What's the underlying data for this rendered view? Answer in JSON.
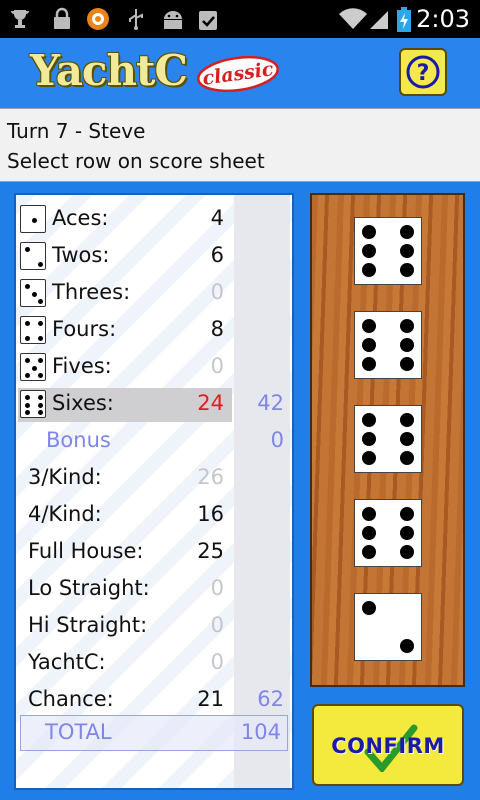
{
  "status_bar": {
    "time": "2:03",
    "icons": [
      "trophy-icon",
      "lock-icon",
      "avast-icon",
      "usb-icon",
      "android-icon",
      "clipboard-check-icon",
      "wifi-icon",
      "signal-icon",
      "battery-charging-icon"
    ]
  },
  "header": {
    "title": "YachtC",
    "badge": "classic",
    "help_label": "?"
  },
  "message": {
    "turn": "Turn 7 - Steve",
    "instruction": "Select row on score sheet"
  },
  "score_sheet": {
    "upper": [
      {
        "label": "Aces:",
        "value": "4",
        "die": 1,
        "state": "scored"
      },
      {
        "label": "Twos:",
        "value": "6",
        "die": 2,
        "state": "scored"
      },
      {
        "label": "Threes:",
        "value": "0",
        "die": 3,
        "state": "potential"
      },
      {
        "label": "Fours:",
        "value": "8",
        "die": 4,
        "state": "scored"
      },
      {
        "label": "Fives:",
        "value": "0",
        "die": 5,
        "state": "potential"
      },
      {
        "label": "Sixes:",
        "value": "24",
        "die": 6,
        "state": "selected",
        "subtotal": "42"
      }
    ],
    "bonus": {
      "label": "Bonus",
      "value": "0"
    },
    "lower": [
      {
        "label": "3/Kind:",
        "value": "26",
        "state": "potential"
      },
      {
        "label": "4/Kind:",
        "value": "16",
        "state": "scored"
      },
      {
        "label": "Full House:",
        "value": "25",
        "state": "scored"
      },
      {
        "label": "Lo Straight:",
        "value": "0",
        "state": "potential"
      },
      {
        "label": "Hi Straight:",
        "value": "0",
        "state": "potential"
      },
      {
        "label": "YachtC:",
        "value": "0",
        "state": "potential"
      },
      {
        "label": "Chance:",
        "value": "21",
        "state": "scored",
        "subtotal": "62"
      }
    ],
    "total": {
      "label": "TOTAL",
      "value": "104"
    }
  },
  "dice": [
    6,
    6,
    6,
    6,
    2
  ],
  "confirm_label": "CONFIRM",
  "colors": {
    "background": "#1f7ee8",
    "selected_value": "#e21c1c",
    "potential_value": "#c4c6cc",
    "total_text": "#7f86e6",
    "button_yellow": "#f3ea3d"
  }
}
